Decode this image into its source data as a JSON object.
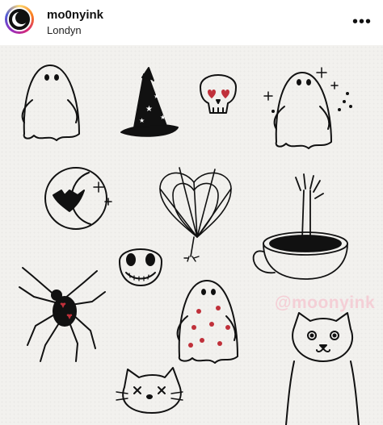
{
  "header": {
    "username": "mo0nyink",
    "location": "Londyn",
    "more_icon": "more-dots-icon"
  },
  "post": {
    "watermark": "@moonyink",
    "drawings": [
      "ghost-icon",
      "witch-hat-icon",
      "skull-icon",
      "sparkle-ghost-icon",
      "moon-bat-icon",
      "heart-web-icon",
      "skeleton-coffee-icon",
      "jack-skellington-icon",
      "spider-icon",
      "heart-ghost-icon",
      "cat-icon",
      "hello-kitty-icon"
    ],
    "accent": "#c0303a"
  }
}
